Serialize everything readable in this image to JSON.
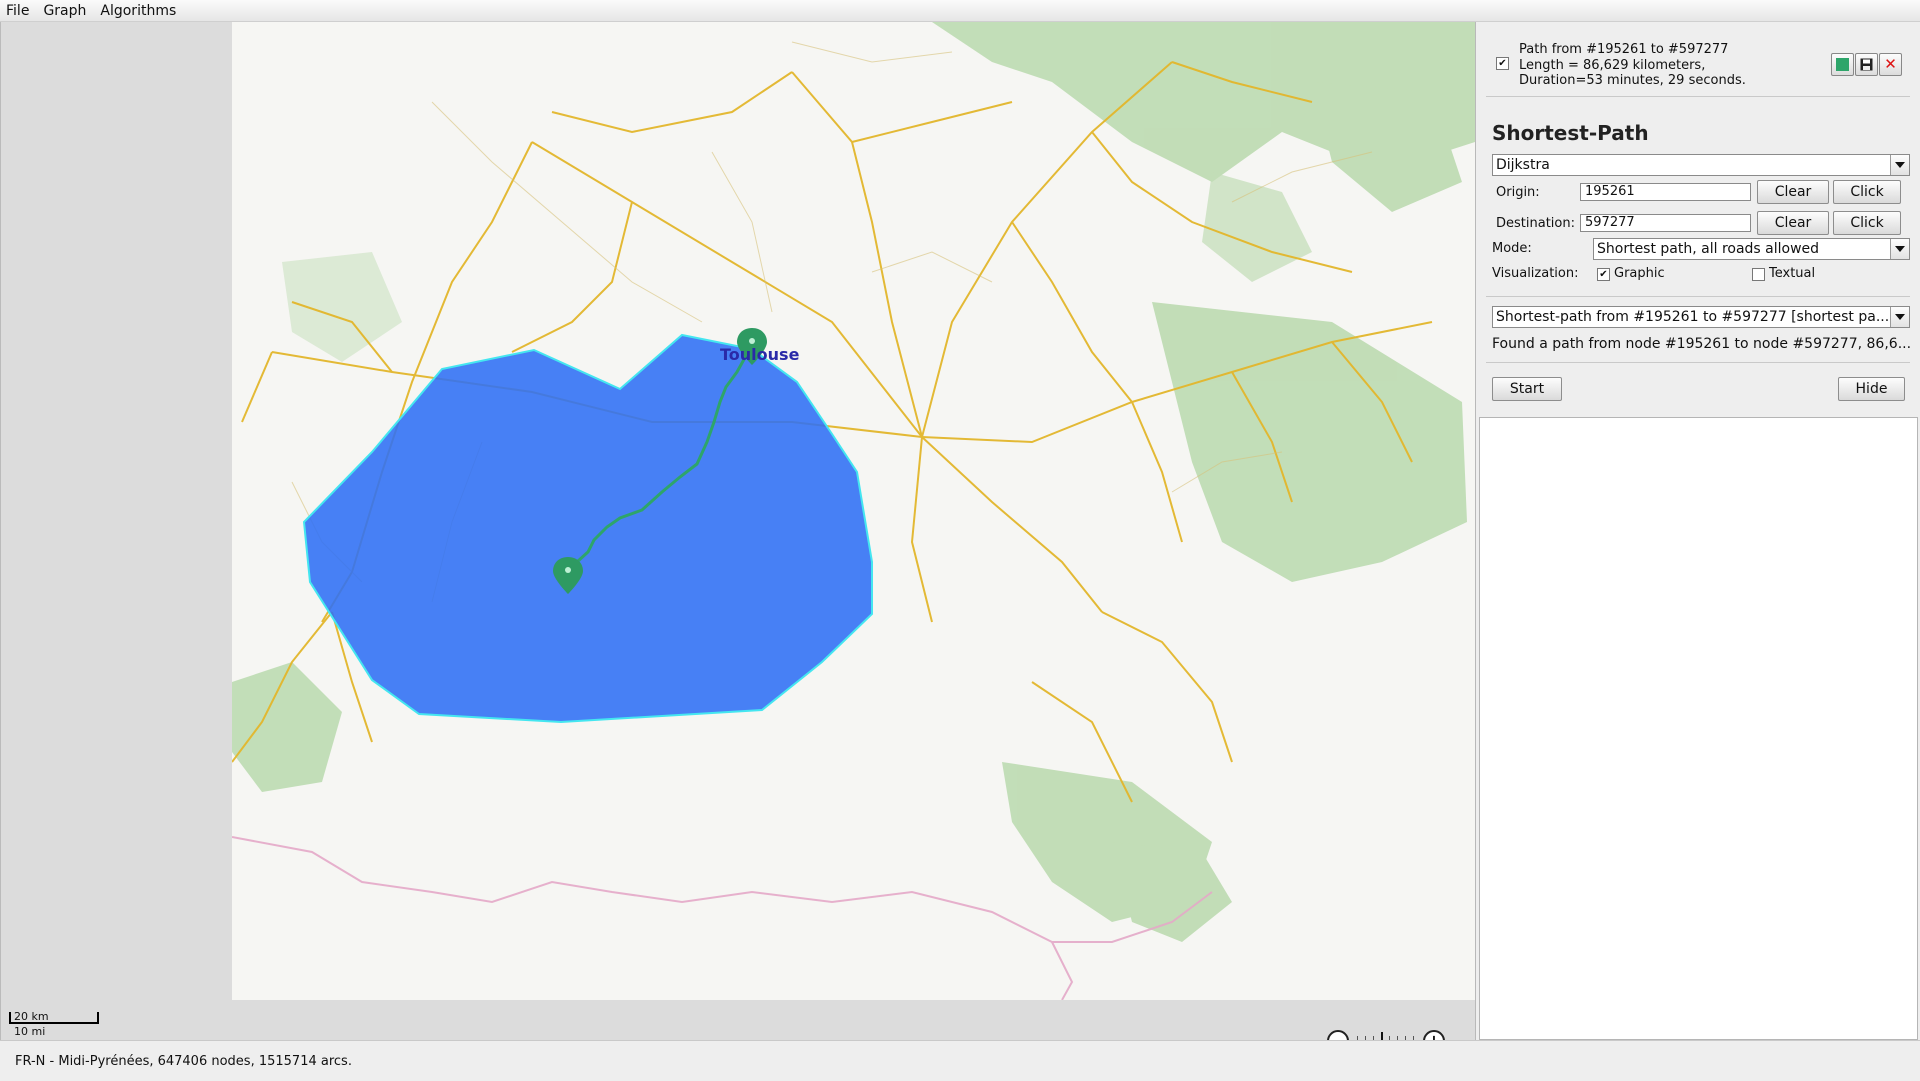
{
  "menu": [
    "File",
    "Graph",
    "Algorithms"
  ],
  "map": {
    "city_label": "Toulouse",
    "scale_km": "20 km",
    "scale_mi": "10 mi",
    "colors": {
      "isochrone_fill": "#2f6ff5",
      "isochrone_stroke": "#44e6f0",
      "path": "#2ea56a",
      "marker": "#2e9a62",
      "road": "#e8b927"
    }
  },
  "path_entry": {
    "checked": true,
    "title": "Path from #195261 to #597277",
    "description": "Length = 86,629 kilometers, Duration=53 minutes, 29 seconds.",
    "color_button_color": "#2ea56a"
  },
  "shortest_path": {
    "title": "Shortest-Path",
    "algorithm": "Dijkstra",
    "origin_label": "Origin:",
    "origin_value": "195261",
    "destination_label": "Destination:",
    "destination_value": "597277",
    "clear_label": "Clear",
    "click_label": "Click",
    "mode_label": "Mode:",
    "mode_value": "Shortest path, all roads allowed",
    "visualization_label": "Visualization:",
    "graphic_label": "Graphic",
    "graphic_checked": true,
    "textual_label": "Textual",
    "textual_checked": false,
    "solution_select": "Shortest-path from #195261 to #597277 [shortest pa...",
    "solution_text": "Found a path from node #195261 to node #597277, 86,6...",
    "start_label": "Start",
    "hide_label": "Hide"
  },
  "status": "FR-N - Midi-Pyrénées, 647406 nodes, 1515714 arcs."
}
